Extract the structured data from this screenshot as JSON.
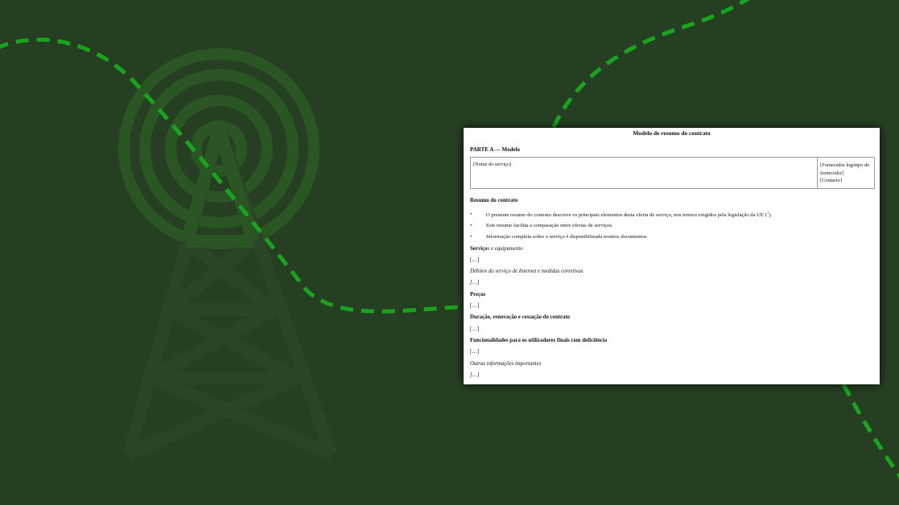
{
  "document": {
    "title": "Modelo de resumo do contrato",
    "part": "PARTE A — Modelo",
    "table": {
      "service_name": "[Nome do serviço]",
      "provider_logo": "[Fornecedor logótipo do fornecedor]",
      "contact": "[Contacto]"
    },
    "summary_heading": "Resumo do contrato",
    "bullet_symbol": "•",
    "bullets": [
      "O presente resumo do contrato descreve os principais elementos desta oferta de serviço, nos termos exigidos pela legislação da UE (",
      "Este resumo facilita a comparação entre ofertas de serviços.",
      "Informação completa sobre o serviço é disponibilizada noutros documentos."
    ],
    "footnote_open": "",
    "footnote_mark": "1",
    "footnote_close": ").",
    "sections": {
      "services_bold": "Serviço",
      "services_italic": "s e equipamento",
      "services_body": "[…]",
      "internet_heading": "Débitos do serviço de Internet e medidas corretivas",
      "internet_body": "[…]",
      "prices_heading": "Preços",
      "prices_body": "[…]",
      "duration_heading": "Duração, renovação e cessação do contrato",
      "duration_body": "[…]",
      "accessibility_heading": "Funcionalidades para os utilizadores finais com deficiência",
      "accessibility_body": "[…]",
      "other_heading": "Outras informações importantes",
      "other_body": "[…]"
    }
  },
  "colors": {
    "background": "#263f22",
    "dashed_line": "#17a51e",
    "tower_art": "#2e5a28",
    "link": "#3a57b0"
  },
  "icons": {
    "background_art": "radio-tower-icon"
  }
}
